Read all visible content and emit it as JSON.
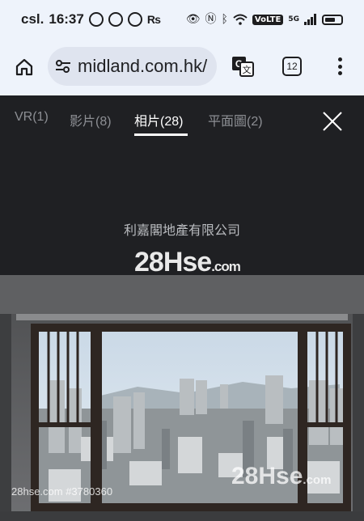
{
  "status_bar": {
    "carrier": "csl.",
    "time": "16:37",
    "volte": "VoLTE",
    "network": "5G"
  },
  "browser": {
    "url": "midland.com.hk/",
    "tab_count": "12"
  },
  "gallery": {
    "tabs": [
      {
        "label": "VR(1)"
      },
      {
        "label": "影片(8)"
      },
      {
        "label": "相片(28)"
      },
      {
        "label": "平面圖(2)"
      }
    ],
    "active_tab": 2,
    "agency_name": "利嘉閣地產有限公司"
  },
  "watermark": {
    "logo_main": "28Hse",
    "logo_suffix": ".com",
    "listing_ref": "28hse.com #3780360"
  },
  "colors": {
    "chrome_bg": "#eef3fb",
    "gallery_bg": "#1f2023",
    "active_tab": "#ffffff",
    "inactive_tab": "#8d8f94"
  }
}
